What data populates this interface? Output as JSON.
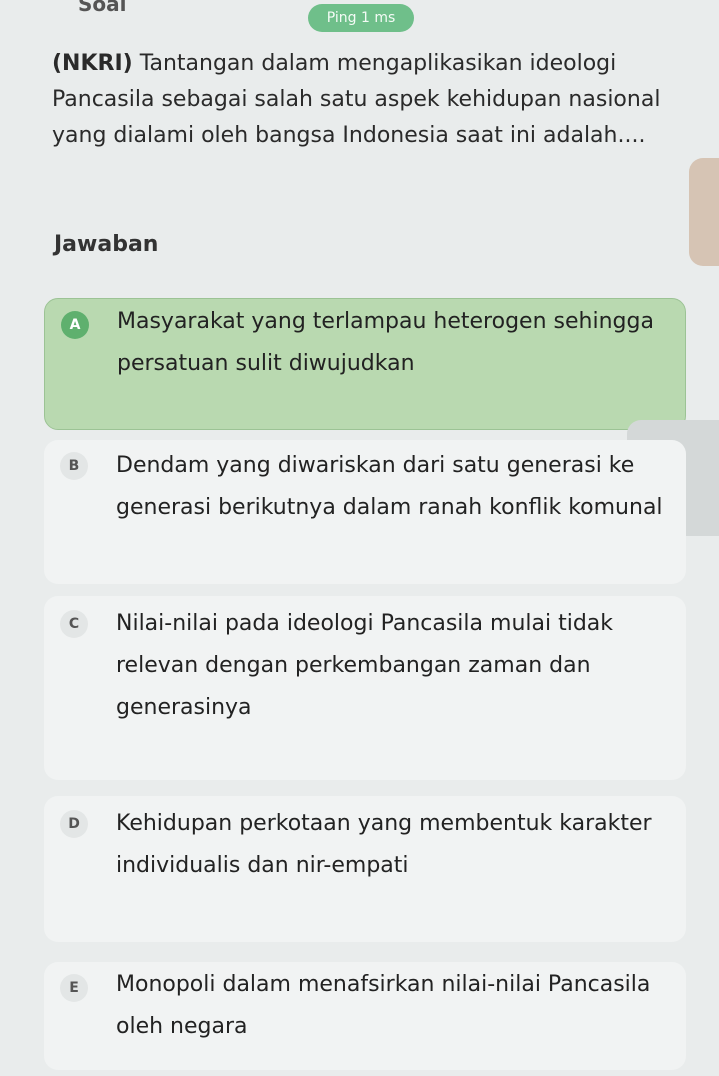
{
  "header": {
    "title": "Soal",
    "ping": "Ping 1 ms"
  },
  "question": {
    "tag": "(NKRI)",
    "text": " Tantangan dalam mengaplikasikan ideologi Pancasila sebagai salah satu aspek kehidupan nasional yang dialami oleh bangsa Indonesia saat ini adalah...."
  },
  "answers": {
    "heading": "Jawaban",
    "selected": "A",
    "options": [
      {
        "letter": "A",
        "text": "Masyarakat yang terlampau heterogen sehingga persatuan sulit diwujudkan"
      },
      {
        "letter": "B",
        "text": "Dendam yang diwariskan dari satu generasi ke generasi berikutnya dalam ranah konflik komunal"
      },
      {
        "letter": "C",
        "text": "Nilai-nilai pada ideologi Pancasila mulai tidak relevan dengan perkembangan zaman dan generasinya"
      },
      {
        "letter": "D",
        "text": "Kehidupan perkotaan yang membentuk karakter individualis dan nir-empati"
      },
      {
        "letter": "E",
        "text": "Monopoli dalam menafsirkan nilai-nilai Pancasila oleh negara"
      }
    ]
  },
  "colors": {
    "selected_bg": "#b9d9b0",
    "selected_badge": "#5fb06e",
    "ping_bg": "#6fbf8a"
  }
}
